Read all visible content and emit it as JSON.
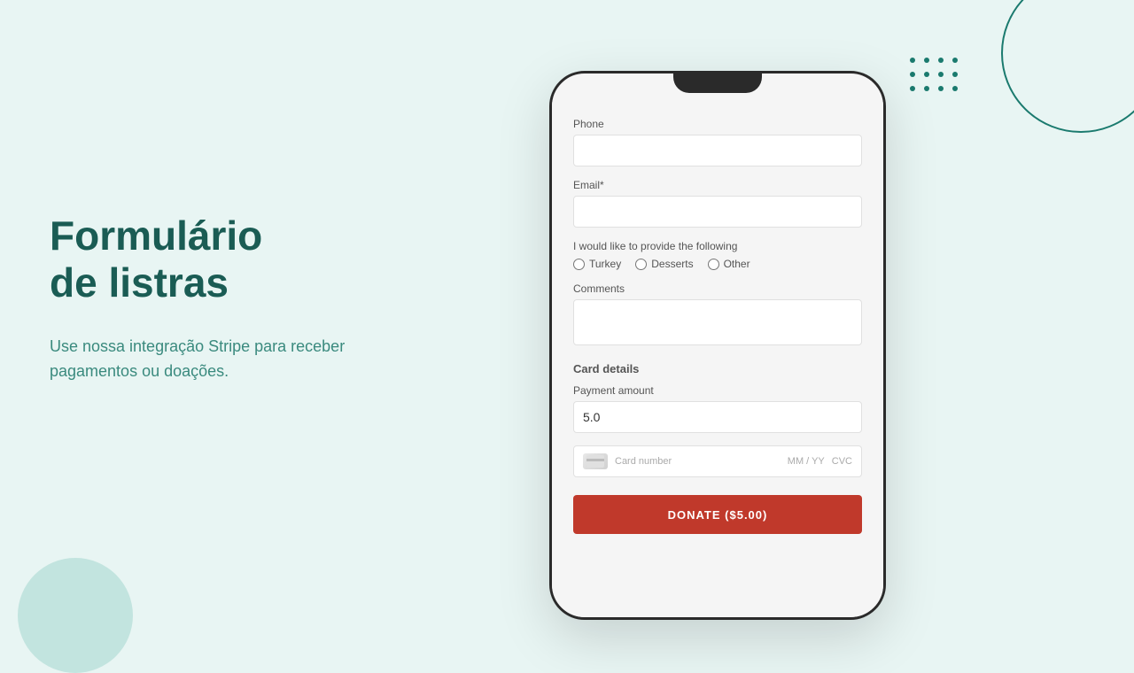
{
  "background_color": "#e8f5f3",
  "decorative": {
    "dots_color": "#1a7a6e",
    "circle_color": "#1a5c54",
    "circle_fill": "#b2ddd6"
  },
  "left": {
    "title_line1": "Formulário",
    "title_line2": "de listras",
    "subtitle": "Use nossa integração Stripe para receber pagamentos ou doações."
  },
  "form": {
    "phone_label": "Phone",
    "phone_placeholder": "",
    "email_label": "Email*",
    "email_placeholder": "",
    "provide_label": "I would like to provide the following",
    "radio_options": [
      {
        "id": "opt-turkey",
        "label": "Turkey"
      },
      {
        "id": "opt-desserts",
        "label": "Desserts"
      },
      {
        "id": "opt-other",
        "label": "Other"
      }
    ],
    "comments_label": "Comments",
    "comments_placeholder": "",
    "card_details_label": "Card details",
    "payment_amount_label": "Payment amount",
    "payment_amount_value": "5.0",
    "card_number_placeholder": "Card number",
    "card_date_placeholder": "MM / YY",
    "card_cvc_placeholder": "CVC",
    "donate_button_label": "DONATE ($5.00)"
  }
}
